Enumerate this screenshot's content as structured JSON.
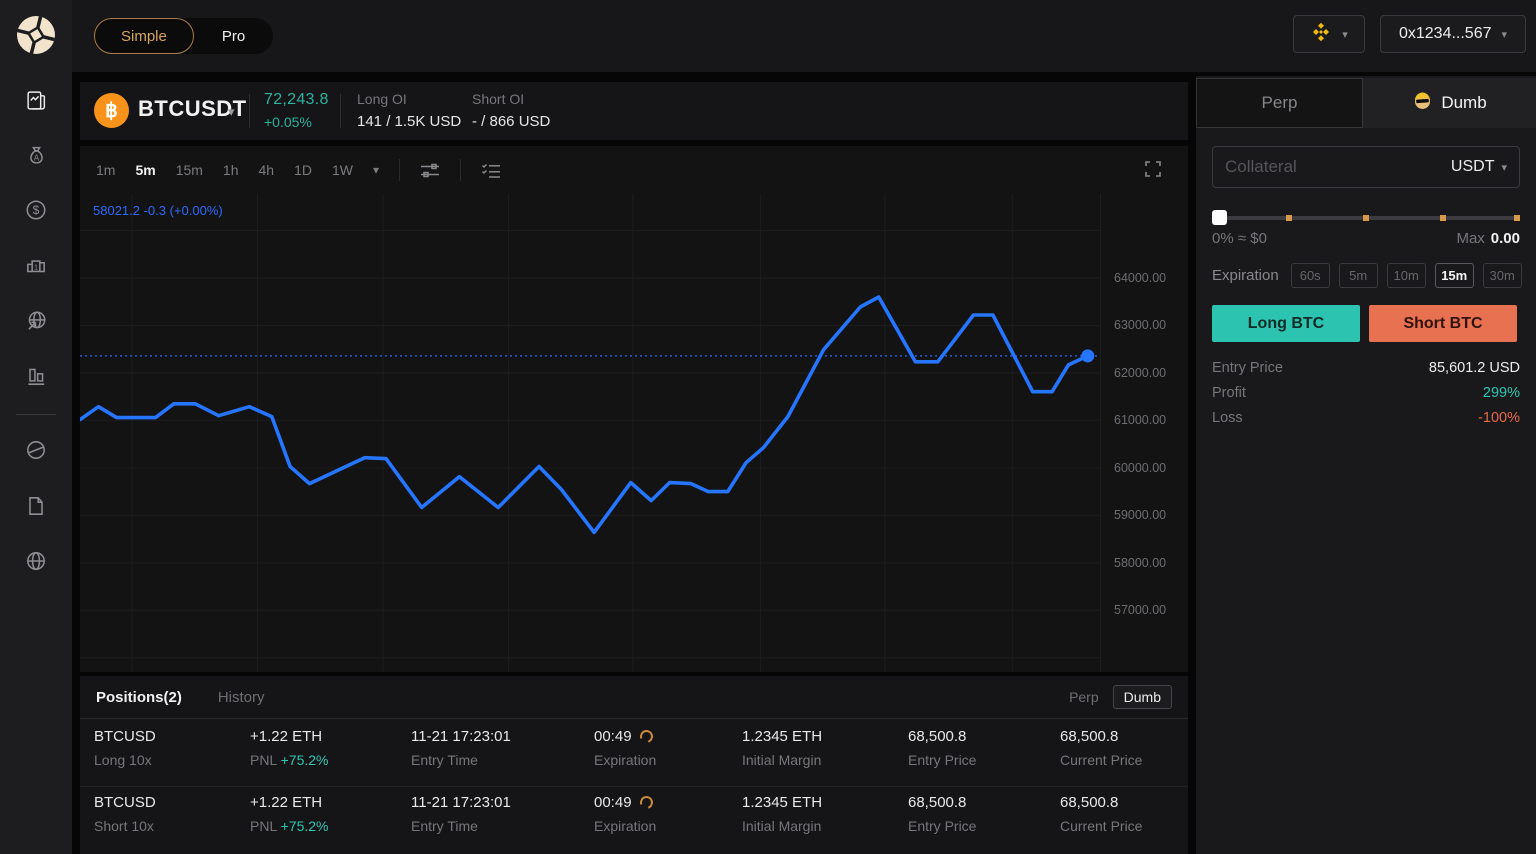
{
  "topbar": {
    "simple": "Simple",
    "pro": "Pro",
    "wallet": "0x1234...567"
  },
  "market": {
    "symbol": "BTCUSDT",
    "price": "72,243.8",
    "change": "+0.05%",
    "long_oi_label": "Long OI",
    "long_oi_value": "141 / 1.5K USD",
    "short_oi_label": "Short OI",
    "short_oi_value": "- / 866 USD"
  },
  "toolbar": {
    "timeframes": [
      "1m",
      "5m",
      "15m",
      "1h",
      "4h",
      "1D",
      "1W"
    ],
    "active_timeframe": "5m"
  },
  "chart_data": {
    "type": "line",
    "title": "BTCUSDT 5m line chart",
    "legend": "58021.2 -0.3 (+0.00%)",
    "legend_position": "top-left",
    "grid": true,
    "ylim": [
      55700,
      65770
    ],
    "yticks": [
      64000,
      63000,
      62000,
      61000,
      60000,
      59000,
      58000,
      57000
    ],
    "extra_gridlines": [
      65000,
      56000
    ],
    "grid_x_fractions": [
      0.051,
      0.174,
      0.297,
      0.42,
      0.542,
      0.667,
      0.789,
      0.914
    ],
    "current_price": 62360,
    "series": [
      {
        "name": "BTCUSDT",
        "x": [
          0.0,
          0.018,
          0.036,
          0.074,
          0.092,
          0.113,
          0.136,
          0.166,
          0.188,
          0.206,
          0.225,
          0.279,
          0.3,
          0.335,
          0.372,
          0.41,
          0.45,
          0.472,
          0.504,
          0.54,
          0.56,
          0.578,
          0.599,
          0.616,
          0.635,
          0.653,
          0.67,
          0.694,
          0.729,
          0.765,
          0.783,
          0.819,
          0.841,
          0.876,
          0.895,
          0.934,
          0.953,
          0.969,
          0.988
        ],
        "values": [
          61015,
          61290,
          61060,
          61060,
          61350,
          61350,
          61100,
          61290,
          61080,
          60030,
          59670,
          60215,
          60195,
          59165,
          59815,
          59165,
          60030,
          59545,
          58640,
          59690,
          59310,
          59690,
          59670,
          59500,
          59500,
          60110,
          60425,
          61080,
          62490,
          63390,
          63600,
          62235,
          62235,
          63220,
          63220,
          61605,
          61605,
          62170,
          62360
        ]
      }
    ]
  },
  "trade": {
    "tab_perp": "Perp",
    "tab_dumb": "Dumb",
    "collateral_placeholder": "Collateral",
    "collateral_value": "",
    "collateral_currency": "USDT",
    "slider_left": "0% ≈ $0",
    "max_label": "Max",
    "max_value": "0.00",
    "slider_tick_positions": [
      25,
      50,
      75,
      100
    ],
    "expiration_label": "Expiration",
    "expiration_options": [
      "60s",
      "5m",
      "10m",
      "15m",
      "30m"
    ],
    "expiration_active": "15m",
    "long_button": "Long BTC",
    "short_button": "Short BTC",
    "info": [
      {
        "label": "Entry Price",
        "value": "85,601.2 USD",
        "type": "neutral"
      },
      {
        "label": "Profit",
        "value": "299%",
        "type": "profit"
      },
      {
        "label": "Loss",
        "value": "-100%",
        "type": "loss"
      }
    ]
  },
  "positions": {
    "tab_positions": "Positions(2)",
    "tab_history": "History",
    "perp_label": "Perp",
    "dumb_label": "Dumb",
    "rows": [
      {
        "symbol": "BTCUSD",
        "side": "Long 10x",
        "direction": "long",
        "size": "+1.22 ETH",
        "pnl_label": "PNL",
        "pnl": "+75.2%",
        "entry_time": "11-21 17:23:01",
        "entry_time_label": "Entry Time",
        "expiration": "00:49",
        "expiration_label": "Expiration",
        "margin": "1.2345 ETH",
        "margin_label": "Initial Margin",
        "entry_price": "68,500.8",
        "entry_price_label": "Entry Price",
        "current_price": "68,500.8",
        "current_price_label": "Current Price"
      },
      {
        "symbol": "BTCUSD",
        "side": "Short 10x",
        "direction": "short",
        "size": "+1.22 ETH",
        "pnl_label": "PNL",
        "pnl": "+75.2%",
        "entry_time": "11-21 17:23:01",
        "entry_time_label": "Entry Time",
        "expiration": "00:49",
        "expiration_label": "Expiration",
        "margin": "1.2345 ETH",
        "margin_label": "Initial Margin",
        "entry_price": "68,500.8",
        "entry_price_label": "Entry Price",
        "current_price": "68,500.8",
        "current_price_label": "Current Price"
      }
    ]
  },
  "colors": {
    "accent_blue": "#2b6bff",
    "teal": "#2fc7b4",
    "orange_red": "#e8694a",
    "gold": "#d7a55e",
    "bnb_gold": "#f0b90b",
    "btc_orange": "#f7931a"
  }
}
